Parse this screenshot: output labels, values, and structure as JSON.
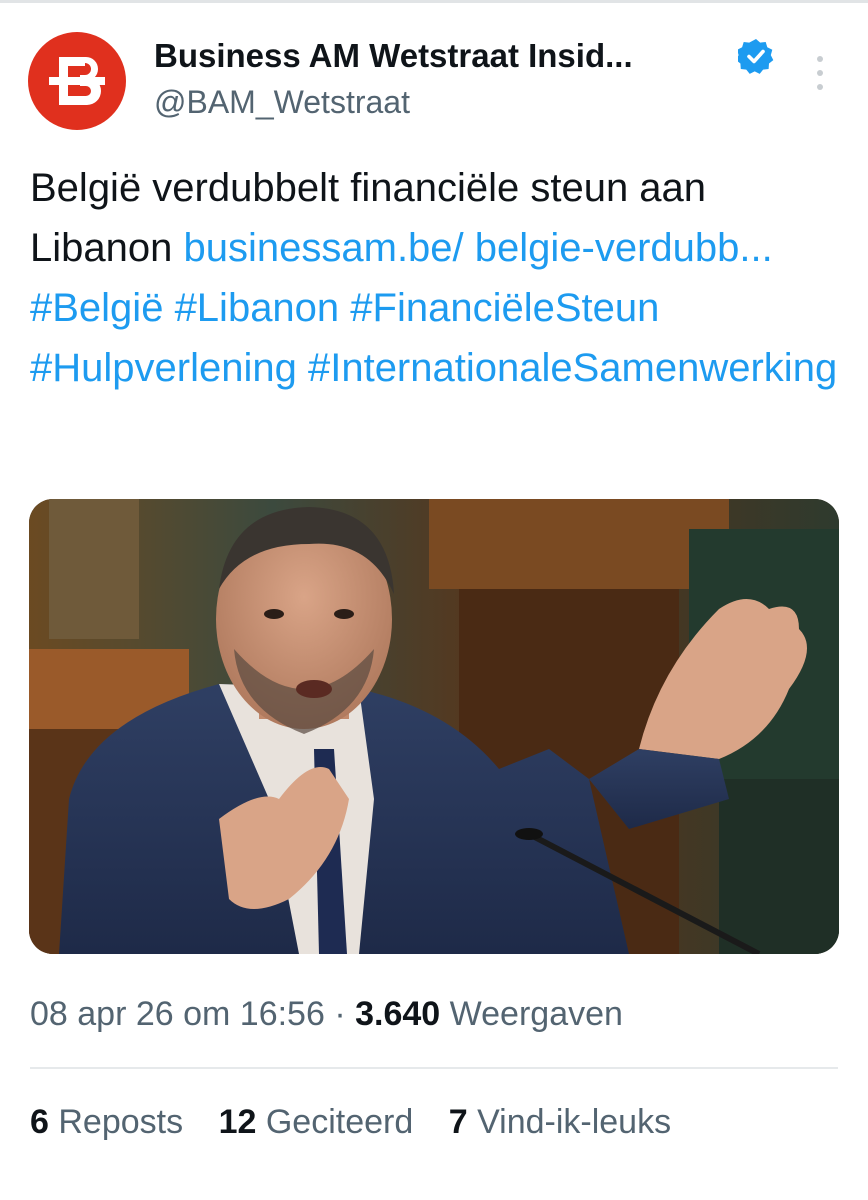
{
  "tweet": {
    "author": {
      "display_name": "Business AM Wetstraat Insid...",
      "handle": "@BAM_Wetstraat",
      "verified": true,
      "avatar_icon": "business-am-logo-icon",
      "avatar_color": "#e0301e"
    },
    "text": {
      "plain": "België verdubbelt financiële steun aan Libanon",
      "link": "businessam.be/ belgie-verdubb...",
      "hashtags": [
        "#België",
        "#Libanon",
        "#FinanciëleSteun",
        "#Hulpverlening",
        "#InternationaleSamenwerking"
      ]
    },
    "meta": {
      "timestamp": "08 apr 26 om 16:56",
      "separator": "·",
      "views_count": "3.640",
      "views_label": "Weergaven"
    },
    "stats": {
      "reposts_count": "6",
      "reposts_label": "Reposts",
      "quotes_count": "12",
      "quotes_label": "Geciteerd",
      "likes_count": "7",
      "likes_label": "Vind-ik-leuks"
    }
  },
  "colors": {
    "link": "#1d9bf0",
    "verified": "#1d9bf0",
    "text": "#0f1419",
    "secondary": "#536471"
  }
}
